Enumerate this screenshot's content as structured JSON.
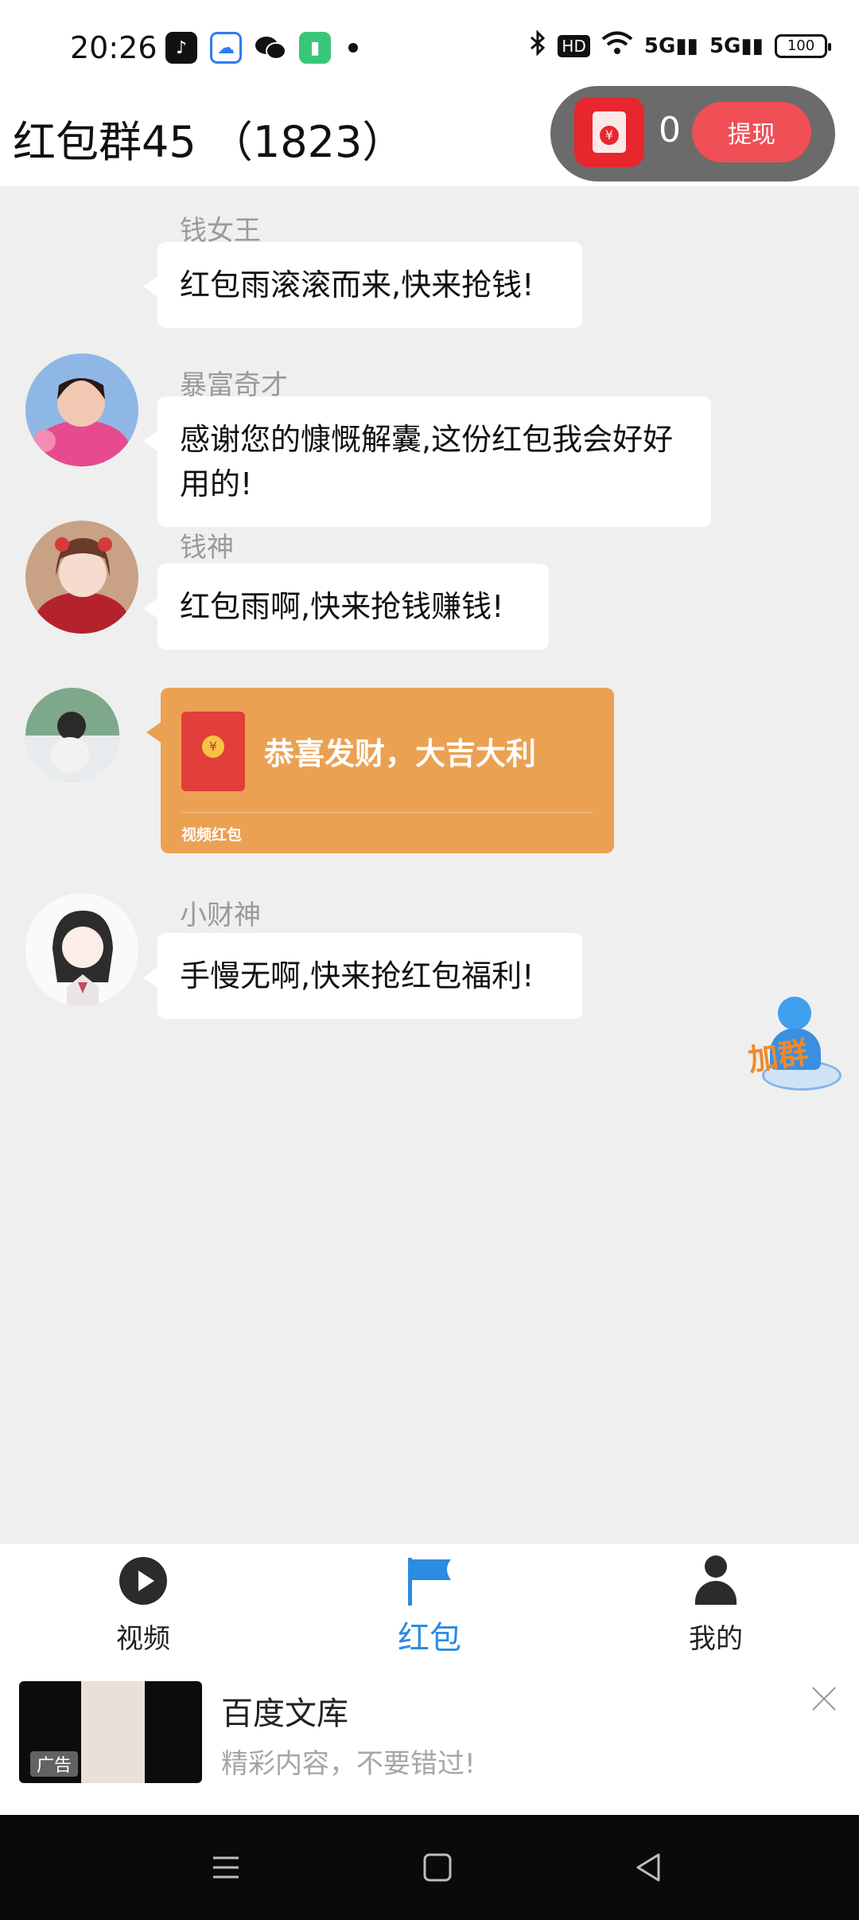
{
  "status_bar": {
    "time": "20:26",
    "battery": "100",
    "hd_label": "HD",
    "signal_1": "5G",
    "signal_2": "5G",
    "notification_icons": [
      "tiktok-icon",
      "baidu-netdisk-icon",
      "wechat-icon",
      "battery-app-icon"
    ],
    "system_icons": [
      "bluetooth-icon",
      "hd-icon",
      "wifi-icon",
      "signal-5g-icon",
      "signal-5g-icon",
      "battery-icon"
    ]
  },
  "header": {
    "title": "红包群45 （1823）",
    "balance": "0",
    "withdraw_label": "提现"
  },
  "messages": [
    {
      "sender": "钱女王",
      "text": "红包雨滚滚而来,快来抢钱!"
    },
    {
      "sender": "暴富奇才",
      "text": "感谢您的慷慨解囊,这份红包我会好好用的!"
    },
    {
      "sender": "钱神",
      "text": "红包雨啊,快来抢钱赚钱!"
    },
    {
      "sender": "",
      "red_packet": {
        "greeting": "恭喜发财，大吉大利",
        "type": "视频红包"
      }
    },
    {
      "sender": "小财神",
      "text": "手慢无啊,快来抢红包福利!"
    }
  ],
  "floating": {
    "join_group_label": "加群"
  },
  "tabs": [
    {
      "label": "视频",
      "icon": "play-circle-icon"
    },
    {
      "label": "红包",
      "icon": "flag-icon",
      "active": true
    },
    {
      "label": "我的",
      "icon": "person-icon"
    }
  ],
  "ad": {
    "title": "百度文库",
    "subtitle": "精彩内容，不要错过!",
    "badge": "广告"
  },
  "colors": {
    "accent_blue": "#2b8ce0",
    "withdraw_red": "#ef4f55",
    "red_packet_orange": "#eba152",
    "chat_background": "#efefef"
  }
}
